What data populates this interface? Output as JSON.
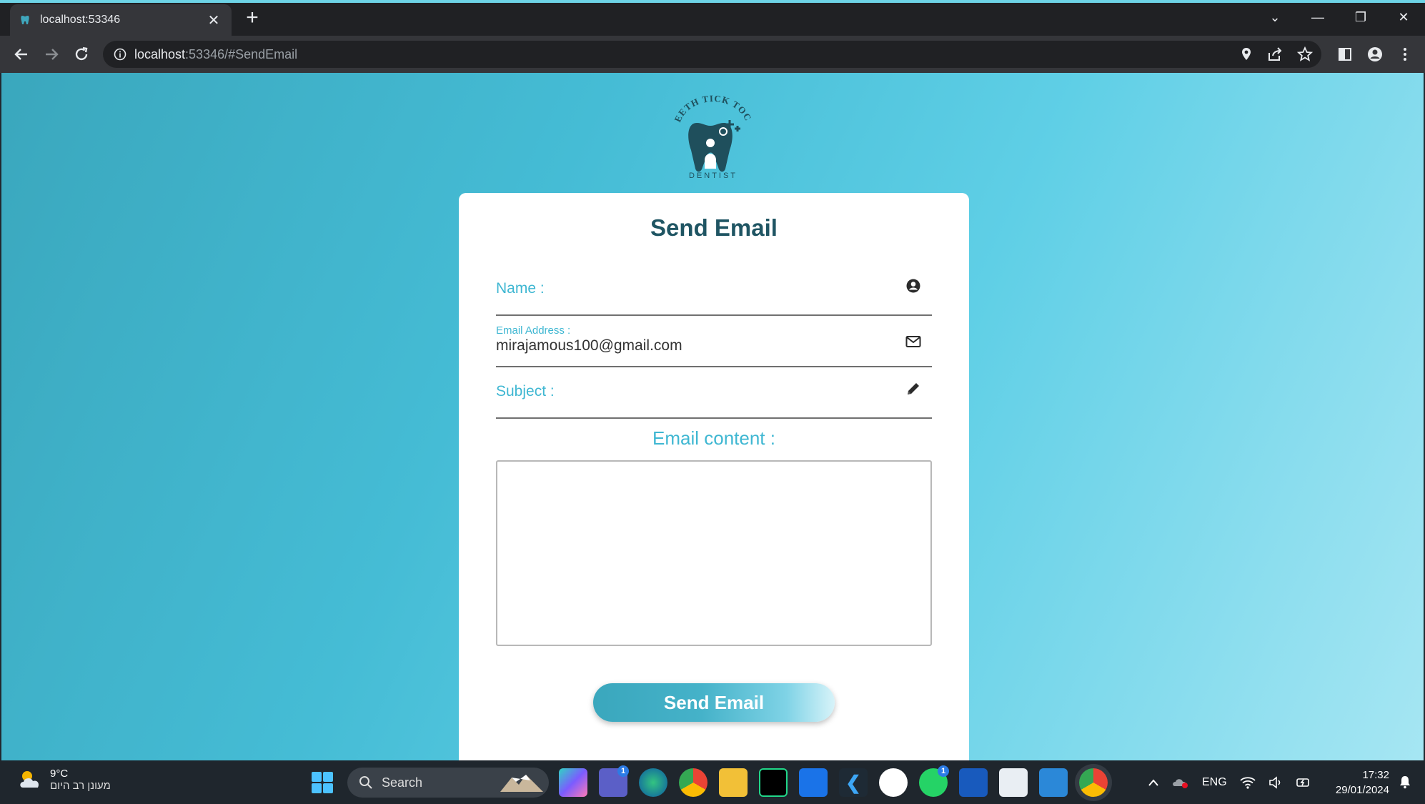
{
  "browser": {
    "tab_title": "localhost:53346",
    "tab_close": "✕",
    "new_tab": "+",
    "url_host": "localhost",
    "url_rest": ":53346/#SendEmail",
    "window_controls": [
      "⌄",
      "—",
      "❐",
      "✕"
    ]
  },
  "logo": {
    "top_text": "TEETH TICK TOCK",
    "bottom_text": "DENTIST"
  },
  "form": {
    "title": "Send Email",
    "name_label": "Name :",
    "email_label": "Email Address :",
    "email_value": "mirajamous100@gmail.com",
    "subject_label": "Subject :",
    "content_label": "Email content :",
    "send_button": "Send Email"
  },
  "taskbar": {
    "weather_temp": "9°C",
    "weather_cond": "מעונן רב היום",
    "search_label": "Search",
    "lang": "ENG",
    "time": "17:32",
    "date": "29/01/2024",
    "badge_teams": "1",
    "badge_whatsapp": "1"
  },
  "colors": {
    "accent": "#3fb7d2",
    "title": "#1f5563",
    "page_bg_start": "#3aa7bd",
    "page_bg_end": "#a6e6f3"
  }
}
